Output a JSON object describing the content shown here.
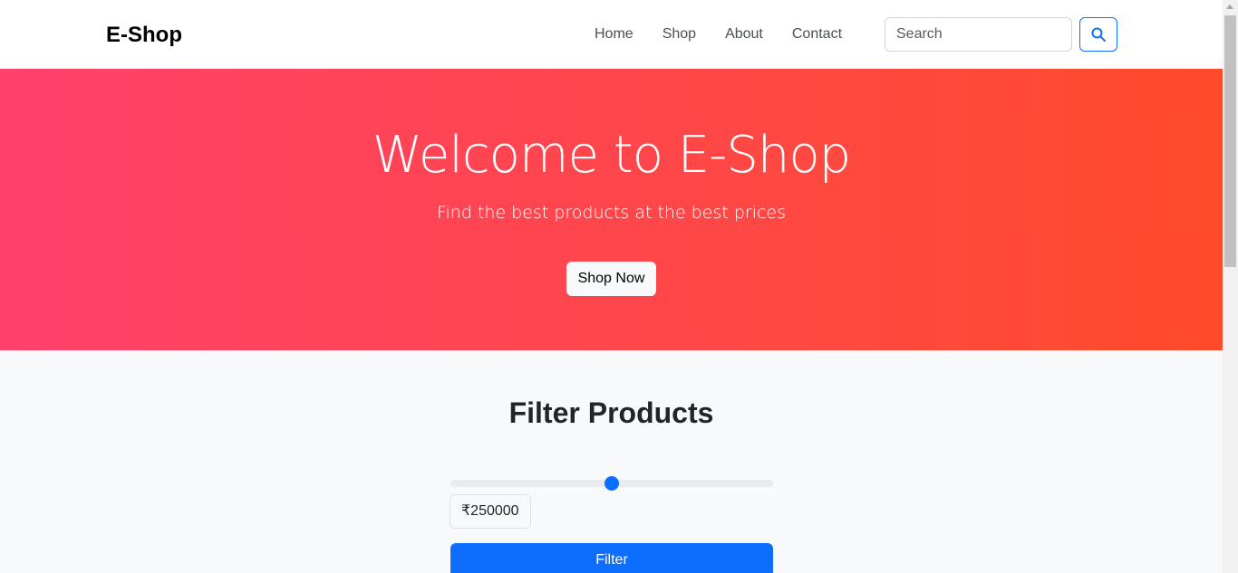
{
  "navbar": {
    "brand": "E-Shop",
    "links": [
      "Home",
      "Shop",
      "About",
      "Contact"
    ],
    "search_placeholder": "Search",
    "search_icon": "search-icon"
  },
  "hero": {
    "title": "Welcome to E-Shop",
    "subtitle": "Find the best products at the best prices",
    "cta_label": "Shop Now",
    "gradient": [
      "#ff416c",
      "#ff4b2b"
    ]
  },
  "filter": {
    "title": "Filter Products",
    "price_value_fraction": 0.5,
    "price_display": "₹250000",
    "button_label": "Filter",
    "accent": "#0d6efd"
  }
}
